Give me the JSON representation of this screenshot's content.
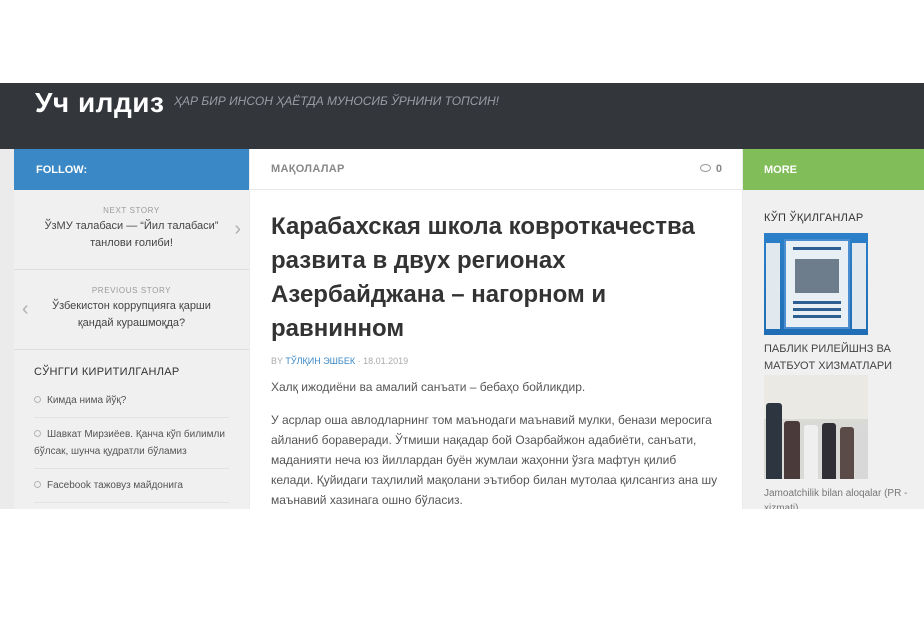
{
  "header": {
    "site_title": "Уч илдиз",
    "tagline": "ҲАР БИР ИНСОН ҲАЁТДА МУНОСИБ ЎРНИНИ ТОПСИН!"
  },
  "left_sidebar": {
    "follow_label": "FOLLOW:",
    "next_story": {
      "caption": "NEXT STORY",
      "title": "ЎзМУ талабаси — “Йил талабаси” танлови ғолиби!"
    },
    "previous_story": {
      "caption": "PREVIOUS STORY",
      "title": "Ўзбекистон коррупцияга қарши қандай курашмоқда?"
    },
    "recent_heading": "СЎНГГИ КИРИТИЛГАНЛАР",
    "recent_items": [
      "Кимда нима йўқ?",
      "Шавкат Мирзиёев. Қанча кўп билимли бўлсак, шунча қудратли бўламиз",
      "Facebook тажовуз майдонига"
    ]
  },
  "main": {
    "section_label": "МАҚОЛАЛАР",
    "comment_count": "0",
    "headline": "Карабахская школа ковроткачества развита в двух регионах Азербайджана – нагорном и равнинном",
    "byline_prefix": "BY",
    "author": "ТЎЛҚИН ЭШБЕК",
    "date": "· 18.01.2019",
    "lead": "Халқ ижодиёни ва амалий санъати – бебаҳо бойликдир.",
    "body": "У асрлар оша авлодларнинг том маънодаги маънавий мулки, бенази меросига айланиб бораверади. Ўтмиши нақадар бой Озарбайжон адабиёти, санъати, маданияти неча юз йиллардан буён жумлаи жаҳонни ўзга мафтун қилиб келади. Қуйидаги таҳлилий мақолани эътибор билан мутолаа қилсангиз ана шу маънавий хазинага ошно бўласиз."
  },
  "right_sidebar": {
    "more_label": "MORE",
    "popular_heading": "КЎП ЎҚИЛГАНЛАР",
    "item1_caption": "ПАБЛИК РИЛЕЙШНЗ ВА МАТБУОТ ХИЗМАТЛАРИ",
    "item2_caption": "Jamoatchilik bilan aloqalar (PR - xizmati)"
  },
  "icons": [
    "chevron-right-icon",
    "chevron-left-icon",
    "comment-bubble-icon",
    "circle-bullet-icon"
  ],
  "colors": {
    "header": "#33363b",
    "follow": "#3a88c6",
    "more": "#81bd58",
    "link": "#3a88c6"
  }
}
